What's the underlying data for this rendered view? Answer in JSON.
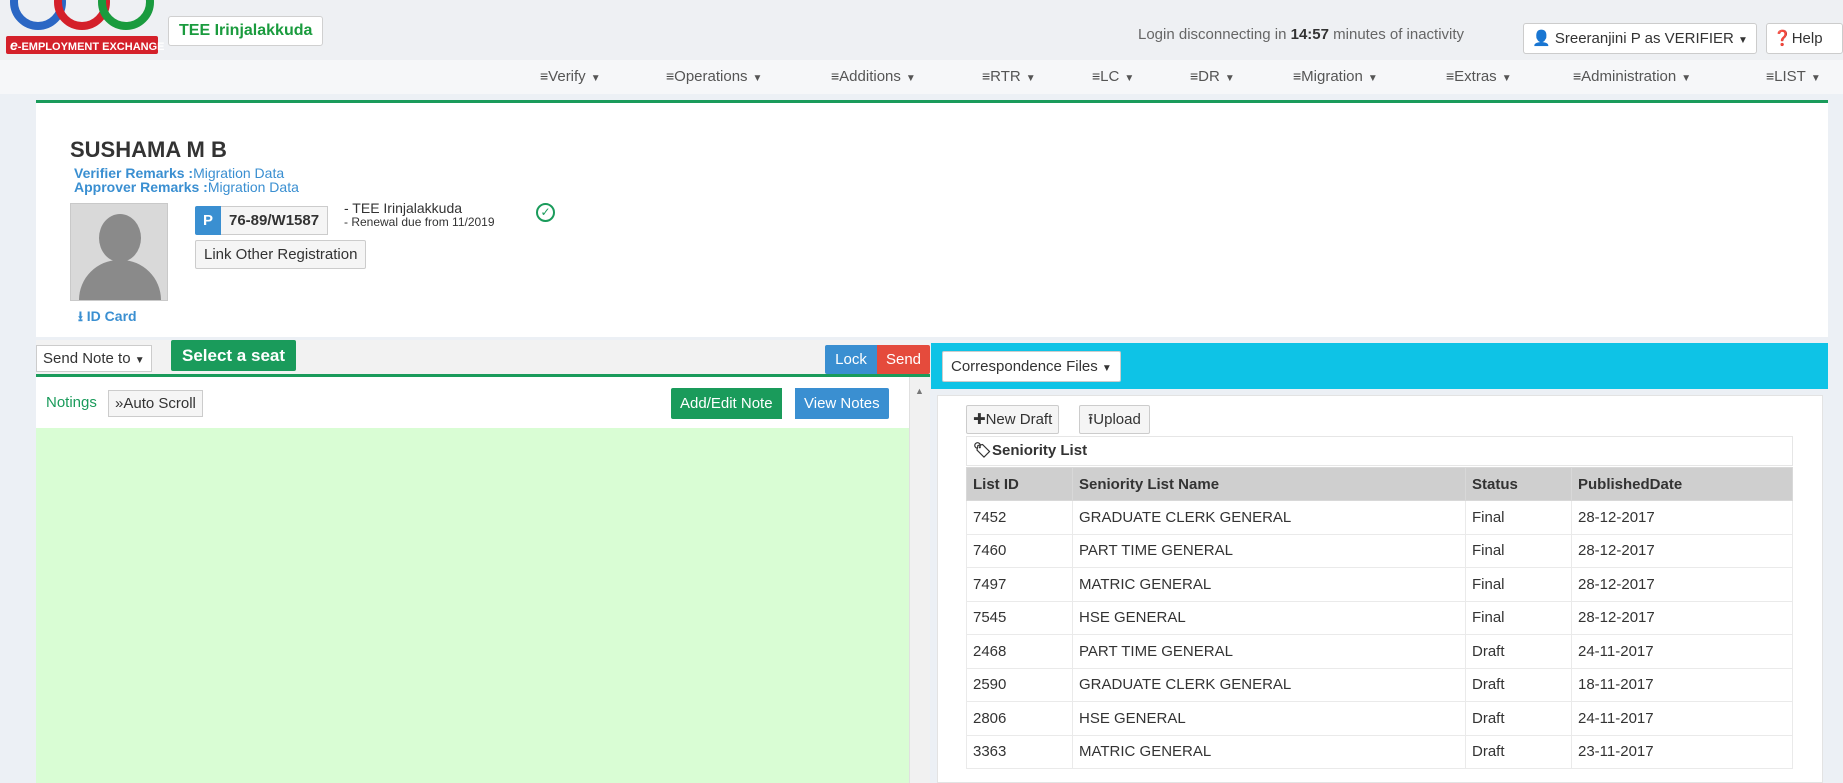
{
  "header": {
    "logo_text_e": "e",
    "logo_text": "-EMPLOYMENT EXCHANGE",
    "office": "TEE Irinjalakkuda",
    "inactivity_prefix": "Login disconnecting in",
    "inactivity_time": "14:57",
    "inactivity_suffix": "minutes of inactivity",
    "user": "Sreeranjini P as VERIFIER",
    "help": "Help"
  },
  "nav": {
    "items": [
      {
        "label": "Verify"
      },
      {
        "label": "Operations"
      },
      {
        "label": "Additions"
      },
      {
        "label": "RTR"
      },
      {
        "label": "LC"
      },
      {
        "label": "DR"
      },
      {
        "label": "Migration"
      },
      {
        "label": "Extras"
      },
      {
        "label": "Administration"
      },
      {
        "label": "LIST"
      }
    ]
  },
  "profile": {
    "name": "SUSHAMA M B",
    "verifier_label": "Verifier Remarks :",
    "verifier_value": "Migration Data",
    "approver_label": "Approver Remarks :",
    "approver_value": "Migration Data",
    "reg_type": "P",
    "reg_no": "76-89/W1587",
    "reg_office": "- TEE Irinjalakkuda",
    "renewal": "- Renewal due from 11/2019",
    "link_btn": "Link Other Registration",
    "id_card": "ID Card"
  },
  "notes": {
    "send_note": "Send Note to",
    "select_seat": "Select a seat",
    "lock": "Lock",
    "send": "Send",
    "notings": "Notings",
    "auto_scroll": "Auto Scroll",
    "add_edit": "Add/Edit Note",
    "view_notes": "View Notes"
  },
  "correspondence": {
    "files_btn": "Correspondence Files",
    "new_draft": "New Draft",
    "upload": "Upload",
    "section_title": "Seniority List",
    "columns": [
      "List ID",
      "Seniority List Name",
      "Status",
      "PublishedDate"
    ],
    "rows": [
      [
        "7452",
        "GRADUATE CLERK GENERAL",
        "Final",
        "28-12-2017"
      ],
      [
        "7460",
        "PART TIME GENERAL",
        "Final",
        "28-12-2017"
      ],
      [
        "7497",
        "MATRIC GENERAL",
        "Final",
        "28-12-2017"
      ],
      [
        "7545",
        "HSE GENERAL",
        "Final",
        "28-12-2017"
      ],
      [
        "2468",
        "PART TIME GENERAL",
        "Draft",
        "24-11-2017"
      ],
      [
        "2590",
        "GRADUATE CLERK GENERAL",
        "Draft",
        "18-11-2017"
      ],
      [
        "2806",
        "HSE GENERAL",
        "Draft",
        "24-11-2017"
      ],
      [
        "3363",
        "MATRIC GENERAL",
        "Draft",
        "23-11-2017"
      ]
    ]
  }
}
